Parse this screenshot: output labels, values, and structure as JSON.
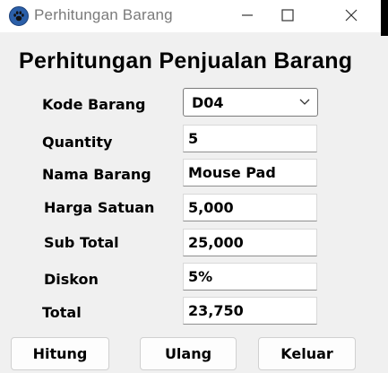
{
  "window": {
    "title": "Perhitungan Barang",
    "app_icon": "paw-icon",
    "controls": [
      "minimize-icon",
      "maximize-icon",
      "close-icon"
    ]
  },
  "form": {
    "heading": "Perhitungan Penjualan Barang",
    "kode_barang": {
      "label": "Kode Barang",
      "value": "D04"
    },
    "quantity": {
      "label": "Quantity",
      "value": "5"
    },
    "nama_barang": {
      "label": "Nama Barang",
      "value": "Mouse Pad"
    },
    "harga_satuan": {
      "label": "Harga Satuan",
      "value": "5,000"
    },
    "sub_total": {
      "label": "Sub Total",
      "value": "25,000"
    },
    "diskon": {
      "label": "Diskon",
      "value": "5%"
    },
    "total": {
      "label": "Total",
      "value": "23,750"
    }
  },
  "buttons": {
    "hitung": "Hitung",
    "ulang": "Ulang",
    "keluar": "Keluar"
  }
}
